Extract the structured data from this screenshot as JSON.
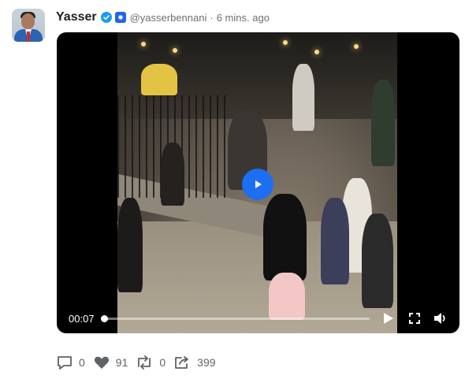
{
  "post": {
    "author_name": "Yasser",
    "handle": "@yasserbennani",
    "separator": "·",
    "time_ago": "6 mins. ago"
  },
  "video": {
    "current_time": "00:07",
    "progress_fraction": 0.01
  },
  "actions": {
    "replies": "0",
    "likes": "91",
    "reposts": "0",
    "shares": "399"
  },
  "colors": {
    "verified": "#1d9bf0",
    "badge": "#2463eb",
    "play_button": "#1d6ff2"
  },
  "icons": [
    "verified-badge-icon",
    "blue-badge-icon",
    "play-icon",
    "fullscreen-icon",
    "volume-icon",
    "comment-icon",
    "heart-icon",
    "repost-icon",
    "share-icon"
  ]
}
